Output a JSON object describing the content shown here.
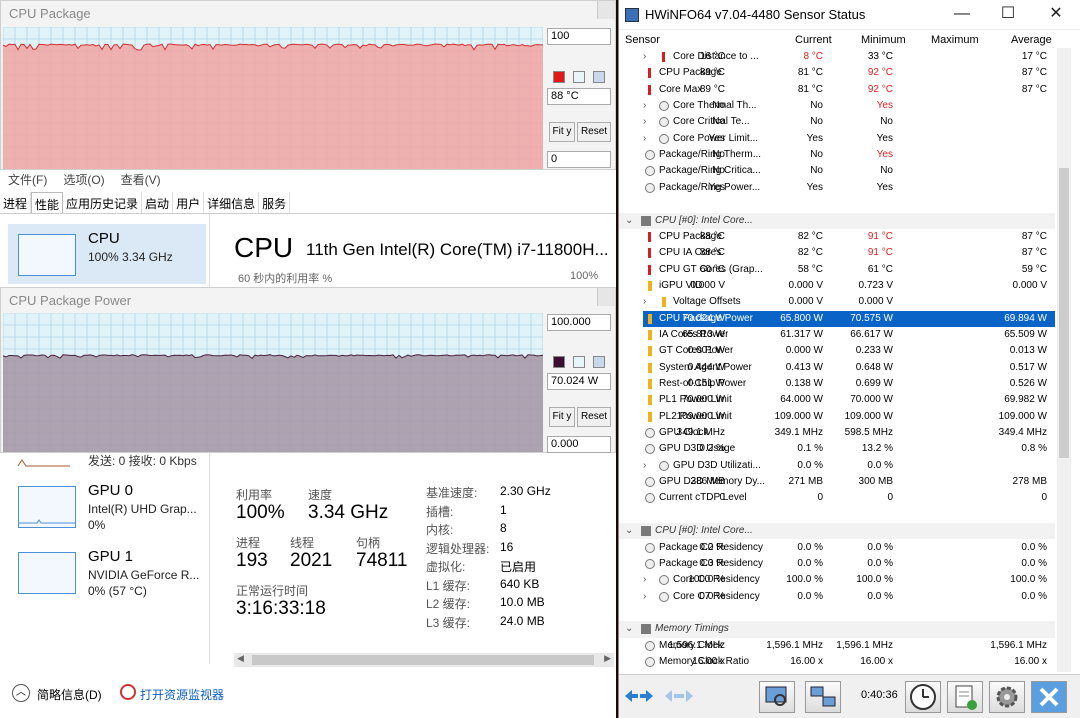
{
  "taskmgr": {
    "menu": [
      "文件(F)",
      "选项(O)",
      "查看(V)"
    ],
    "tabs": [
      "进程",
      "性能",
      "应用历史记录",
      "启动",
      "用户",
      "详细信息",
      "服务"
    ],
    "active_tab": "性能",
    "cpu_item": {
      "name": "CPU",
      "sub": "100%  3.34 GHz"
    },
    "network_sub": "发送: 0  接收: 0 Kbps",
    "gpu0": {
      "name": "GPU 0",
      "sub1": "Intel(R) UHD Grap...",
      "sub2": "0%"
    },
    "gpu1": {
      "name": "GPU 1",
      "sub1": "NVIDIA GeForce R...",
      "sub2": "0% (57 °C)"
    },
    "header_title": "CPU",
    "cpu_model": "11th Gen Intel(R) Core(TM) i7-11800H...",
    "graph_caption": "60 秒内的利用率 %",
    "graph_max": "100%",
    "stats": {
      "util_label": "利用率",
      "util": "100%",
      "speed_label": "速度",
      "speed": "3.34 GHz",
      "proc_label": "进程",
      "proc": "193",
      "thread_label": "线程",
      "thread": "2021",
      "handle_label": "句柄",
      "handle": "74811",
      "uptime_label": "正常运行时间",
      "uptime": "3:16:33:18"
    },
    "kv": [
      {
        "k": "基准速度:",
        "v": "2.30 GHz"
      },
      {
        "k": "插槽:",
        "v": "1"
      },
      {
        "k": "内核:",
        "v": "8"
      },
      {
        "k": "逻辑处理器:",
        "v": "16"
      },
      {
        "k": "虚拟化:",
        "v": "已启用"
      },
      {
        "k": "L1 缓存:",
        "v": "640 KB"
      },
      {
        "k": "L2 缓存:",
        "v": "10.0 MB"
      },
      {
        "k": "L3 缓存:",
        "v": "24.0 MB"
      }
    ],
    "footer": {
      "brief": "简略信息(D)",
      "monitor": "打开资源监视器"
    }
  },
  "graph1": {
    "title": "CPU Package",
    "max": "100",
    "current": "88 °C",
    "min": "0",
    "fit": "Fit y",
    "reset": "Reset",
    "color": "#f2a3a3"
  },
  "graph2": {
    "title": "CPU Package Power",
    "max": "100.000",
    "current": "70.024 W",
    "min": "0.000",
    "fit": "Fit y",
    "reset": "Reset",
    "color": "#a393a3"
  },
  "hwinfo": {
    "title": "HWiNFO64 v7.04-4480 Sensor Status",
    "columns": {
      "sensor": "Sensor",
      "current": "Current",
      "min": "Minimum",
      "max": "Maximum",
      "avg": "Average"
    },
    "rows": [
      {
        "n": "Core Distance to ...",
        "c": "16 °C",
        "mi": "8 °C",
        "ma": "33 °C",
        "a": "17 °C",
        "ind": 2,
        "ic": "temp",
        "mired": true
      },
      {
        "n": "CPU Package",
        "c": "89 °C",
        "mi": "81 °C",
        "ma": "92 °C",
        "a": "87 °C",
        "ind": 1,
        "ic": "temp",
        "mared": true
      },
      {
        "n": "Core Max",
        "c": "89 °C",
        "mi": "81 °C",
        "ma": "92 °C",
        "a": "87 °C",
        "ind": 1,
        "ic": "temp",
        "mared": true
      },
      {
        "n": "Core Thermal Th...",
        "c": "No",
        "mi": "No",
        "ma": "Yes",
        "a": "",
        "ind": 2,
        "ic": "circle",
        "mared": true
      },
      {
        "n": "Core Critical Te...",
        "c": "No",
        "mi": "No",
        "ma": "No",
        "a": "",
        "ind": 2,
        "ic": "circle"
      },
      {
        "n": "Core Power Limit...",
        "c": "Yes",
        "mi": "Yes",
        "ma": "Yes",
        "a": "",
        "ind": 2,
        "ic": "circle"
      },
      {
        "n": "Package/Ring Therm...",
        "c": "No",
        "mi": "No",
        "ma": "Yes",
        "a": "",
        "ind": 1,
        "ic": "circle",
        "mared": true
      },
      {
        "n": "Package/Ring Critica...",
        "c": "No",
        "mi": "No",
        "ma": "No",
        "a": "",
        "ind": 1,
        "ic": "circle"
      },
      {
        "n": "Package/Ring Power...",
        "c": "Yes",
        "mi": "Yes",
        "ma": "Yes",
        "a": "",
        "ind": 1,
        "ic": "circle"
      },
      {
        "n": "",
        "c": "",
        "mi": "",
        "ma": "",
        "a": "",
        "ind": 0,
        "ic": "none"
      },
      {
        "n": "CPU [#0]: Intel Core...",
        "c": "",
        "mi": "",
        "ma": "",
        "a": "",
        "ind": 0,
        "ic": "chip",
        "group": true
      },
      {
        "n": "CPU Package",
        "c": "88 °C",
        "mi": "82 °C",
        "ma": "91 °C",
        "a": "87 °C",
        "ind": 1,
        "ic": "temp",
        "mared": true
      },
      {
        "n": "CPU IA Cores",
        "c": "88 °C",
        "mi": "82 °C",
        "ma": "91 °C",
        "a": "87 °C",
        "ind": 1,
        "ic": "temp",
        "mared": true
      },
      {
        "n": "CPU GT Cores (Grap...",
        "c": "60 °C",
        "mi": "58 °C",
        "ma": "61 °C",
        "a": "59 °C",
        "ind": 1,
        "ic": "temp"
      },
      {
        "n": "iGPU VID",
        "c": "0.000 V",
        "mi": "0.000 V",
        "ma": "0.723 V",
        "a": "0.000 V",
        "ind": 1,
        "ic": "bolt"
      },
      {
        "n": "Voltage Offsets",
        "c": "",
        "mi": "0.000 V",
        "ma": "0.000 V",
        "a": "",
        "ind": 2,
        "ic": "bolt"
      },
      {
        "n": "CPU Package Power",
        "c": "70.024 W",
        "mi": "65.800 W",
        "ma": "70.575 W",
        "a": "69.894 W",
        "ind": 1,
        "ic": "bolt",
        "sel": true
      },
      {
        "n": "IA Cores Power",
        "c": "65.813 W",
        "mi": "61.317 W",
        "ma": "66.617 W",
        "a": "65.509 W",
        "ind": 1,
        "ic": "bolt"
      },
      {
        "n": "GT Cores Power",
        "c": "0.001 W",
        "mi": "0.000 W",
        "ma": "0.233 W",
        "a": "0.013 W",
        "ind": 1,
        "ic": "bolt"
      },
      {
        "n": "System Agent Power",
        "c": "0.444 W",
        "mi": "0.413 W",
        "ma": "0.648 W",
        "a": "0.517 W",
        "ind": 1,
        "ic": "bolt"
      },
      {
        "n": "Rest-of-Chip Power",
        "c": "0.151 W",
        "mi": "0.138 W",
        "ma": "0.699 W",
        "a": "0.526 W",
        "ind": 1,
        "ic": "bolt"
      },
      {
        "n": "PL1 Power Limit",
        "c": "70.000 W",
        "mi": "64.000 W",
        "ma": "70.000 W",
        "a": "69.982 W",
        "ind": 1,
        "ic": "bolt"
      },
      {
        "n": "PL2 Power Limit",
        "c": "109.000 W",
        "mi": "109.000 W",
        "ma": "109.000 W",
        "a": "109.000 W",
        "ind": 1,
        "ic": "bolt"
      },
      {
        "n": "GPU Clock",
        "c": "349.1 MHz",
        "mi": "349.1 MHz",
        "ma": "598.5 MHz",
        "a": "349.4 MHz",
        "ind": 1,
        "ic": "circle"
      },
      {
        "n": "GPU D3D Usage",
        "c": "0.2 %",
        "mi": "0.1 %",
        "ma": "13.2 %",
        "a": "0.8 %",
        "ind": 1,
        "ic": "circle"
      },
      {
        "n": "GPU D3D Utilizati...",
        "c": "",
        "mi": "0.0 %",
        "ma": "0.0 %",
        "a": "",
        "ind": 2,
        "ic": "circle"
      },
      {
        "n": "GPU D3D Memory Dy...",
        "c": "286 MB",
        "mi": "271 MB",
        "ma": "300 MB",
        "a": "278 MB",
        "ind": 1,
        "ic": "circle"
      },
      {
        "n": "Current cTDP Level",
        "c": "0",
        "mi": "0",
        "ma": "0",
        "a": "0",
        "ind": 1,
        "ic": "circle"
      },
      {
        "n": "",
        "c": "",
        "mi": "",
        "ma": "",
        "a": "",
        "ind": 0,
        "ic": "none"
      },
      {
        "n": "CPU [#0]: Intel Core...",
        "c": "",
        "mi": "",
        "ma": "",
        "a": "",
        "ind": 0,
        "ic": "chip",
        "group": true
      },
      {
        "n": "Package C2 Residency",
        "c": "0.0 %",
        "mi": "0.0 %",
        "ma": "0.0 %",
        "a": "0.0 %",
        "ind": 1,
        "ic": "circle"
      },
      {
        "n": "Package C3 Residency",
        "c": "0.0 %",
        "mi": "0.0 %",
        "ma": "0.0 %",
        "a": "0.0 %",
        "ind": 1,
        "ic": "circle"
      },
      {
        "n": "Core C0 Residency",
        "c": "100.0 %",
        "mi": "100.0 %",
        "ma": "100.0 %",
        "a": "100.0 %",
        "ind": 2,
        "ic": "circle"
      },
      {
        "n": "Core C7 Residency",
        "c": "0.0 %",
        "mi": "0.0 %",
        "ma": "0.0 %",
        "a": "0.0 %",
        "ind": 2,
        "ic": "circle"
      },
      {
        "n": "",
        "c": "",
        "mi": "",
        "ma": "",
        "a": "",
        "ind": 0,
        "ic": "none"
      },
      {
        "n": "Memory Timings",
        "c": "",
        "mi": "",
        "ma": "",
        "a": "",
        "ind": 0,
        "ic": "chip",
        "group": true
      },
      {
        "n": "Memory Clock",
        "c": "1,596.1 MHz",
        "mi": "1,596.1 MHz",
        "ma": "1,596.1 MHz",
        "a": "1,596.1 MHz",
        "ind": 1,
        "ic": "circle"
      },
      {
        "n": "Memory Clock Ratio",
        "c": "16.00 x",
        "mi": "16.00 x",
        "ma": "16.00 x",
        "a": "16.00 x",
        "ind": 1,
        "ic": "circle"
      }
    ],
    "timer": "0:40:36"
  }
}
